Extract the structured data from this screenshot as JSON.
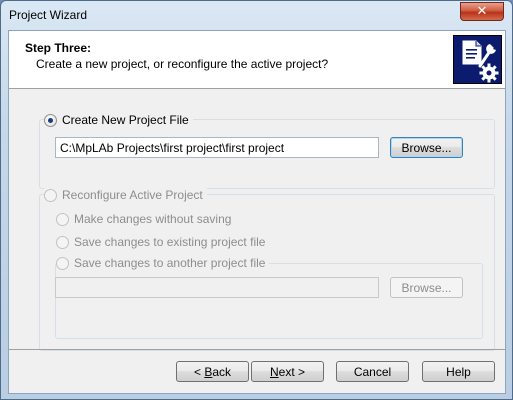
{
  "window": {
    "title": "Project Wizard",
    "close_glyph": "✕"
  },
  "header": {
    "step_title": "Step Three:",
    "step_description": "Create a new project, or reconfigure the active project?",
    "icon": "document-wrench-gear-icon"
  },
  "create_new": {
    "label": "Create New Project File",
    "checked": true,
    "path_value": "C:\\MpLAb Projects\\first project\\first project",
    "browse_label": "Browse..."
  },
  "reconfigure": {
    "label": "Reconfigure Active Project",
    "enabled": false,
    "options": [
      {
        "label": "Make changes without saving"
      },
      {
        "label": "Save changes to existing project file"
      },
      {
        "label": "Save changes to another project file"
      }
    ],
    "path_value": "",
    "browse_label": "Browse..."
  },
  "footer": {
    "back_prefix": "< ",
    "back_mnemonic": "B",
    "back_rest": "ack",
    "next_mnemonic": "N",
    "next_rest": "ext >",
    "cancel_label": "Cancel",
    "help_label": "Help"
  },
  "colors": {
    "icon_background": "#0d1b6e",
    "close_button": "#c7472a",
    "disabled_text": "#8d8d8d"
  }
}
